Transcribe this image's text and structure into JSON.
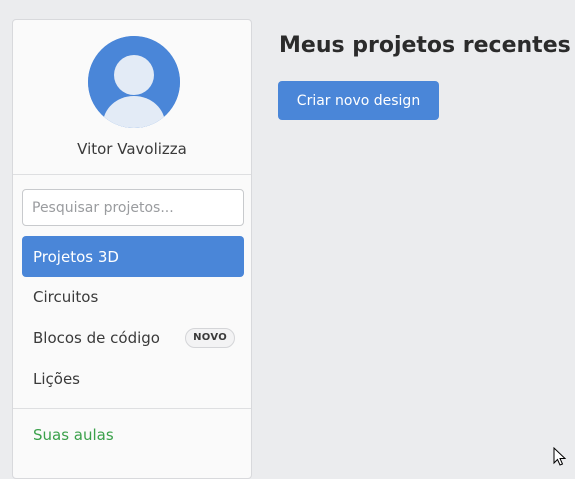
{
  "user": {
    "name": "Vitor Vavolizza",
    "avatar_icon": "user-avatar-icon"
  },
  "search": {
    "placeholder": "Pesquisar projetos...",
    "value": ""
  },
  "nav": {
    "items": [
      {
        "label": "Projetos 3D",
        "active": true
      },
      {
        "label": "Circuitos",
        "active": false
      },
      {
        "label": "Blocos de código",
        "active": false,
        "badge": "NOVO"
      },
      {
        "label": "Lições",
        "active": false
      }
    ],
    "classes_link": "Suas aulas"
  },
  "main": {
    "title": "Meus projetos recentes",
    "create_button": "Criar novo design"
  },
  "colors": {
    "accent": "#4a86d8",
    "background": "#ebecee",
    "sidebar_background": "#fafafa",
    "link_green": "#3aa04a"
  }
}
